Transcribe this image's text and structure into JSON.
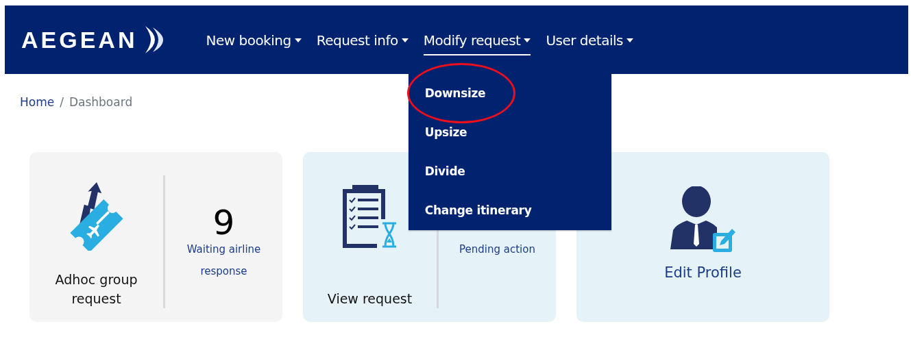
{
  "header": {
    "logo": "AEGEAN",
    "nav": [
      {
        "label": "New booking",
        "selected": false
      },
      {
        "label": "Request info",
        "selected": false
      },
      {
        "label": "Modify request",
        "selected": true,
        "menu": [
          {
            "label": "Downsize",
            "highlighted": true
          },
          {
            "label": "Upsize",
            "highlighted": false
          },
          {
            "label": "Divide",
            "highlighted": false
          },
          {
            "label": "Change itinerary",
            "highlighted": false
          }
        ]
      },
      {
        "label": "User details",
        "selected": false
      }
    ]
  },
  "breadcrumb": {
    "items": [
      "Home",
      "Dashboard"
    ],
    "separator": "/"
  },
  "cards": [
    {
      "kind": "stat",
      "label": "Adhoc group request",
      "count": "9",
      "caption": "Waiting airline response"
    },
    {
      "kind": "stat",
      "label": "View request",
      "caption": "Pending action"
    },
    {
      "kind": "action",
      "label": "Edit Profile"
    }
  ]
}
